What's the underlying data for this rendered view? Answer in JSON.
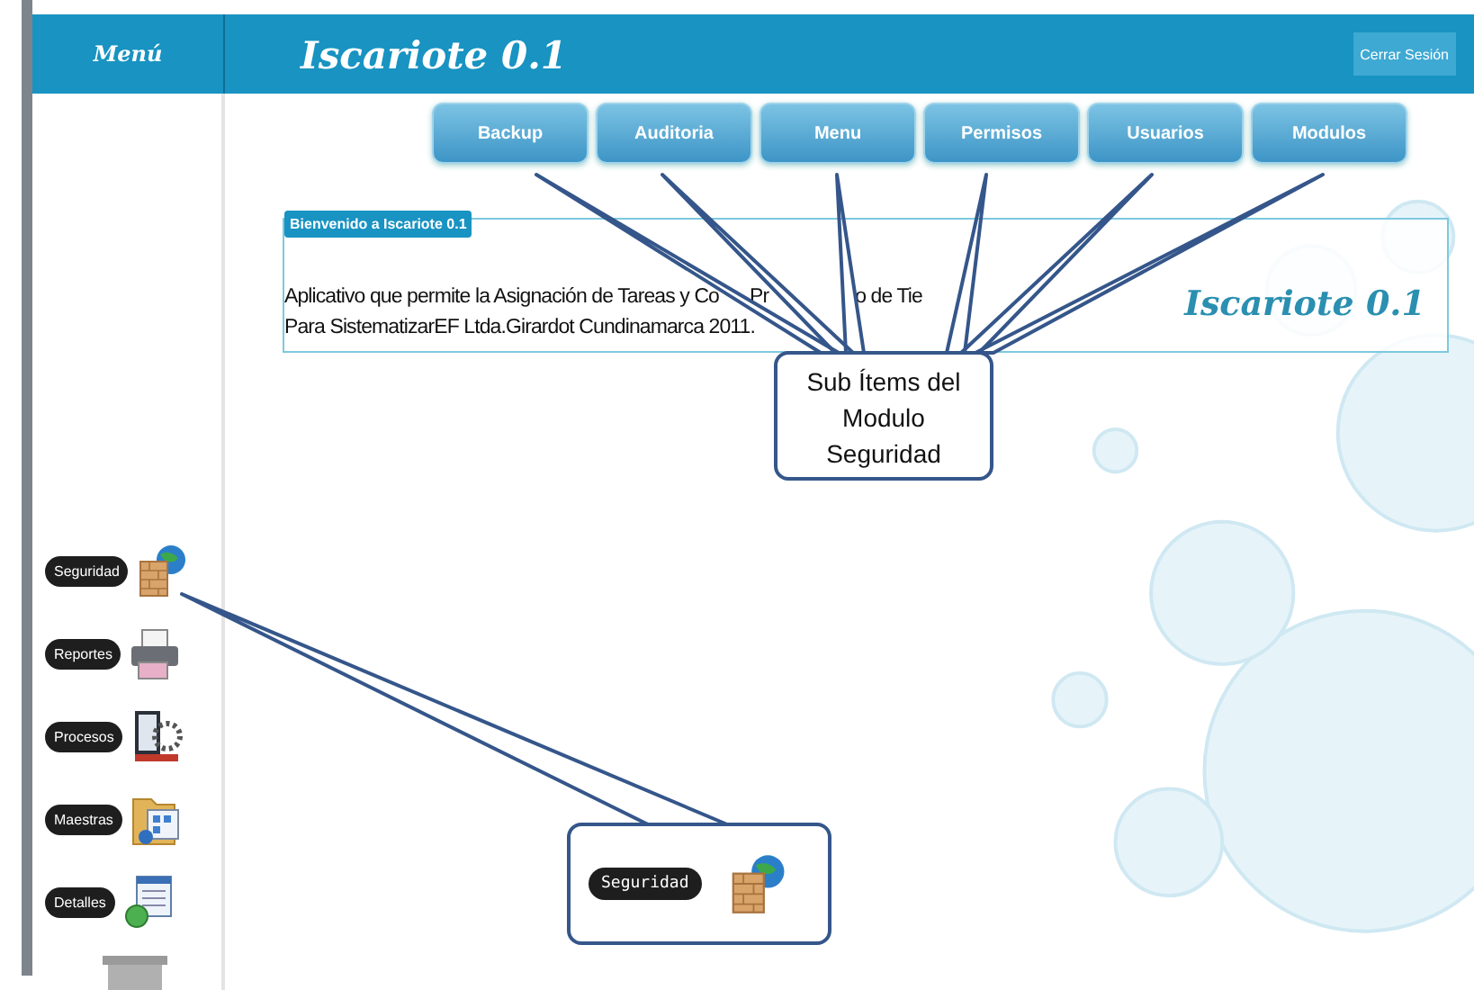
{
  "header": {
    "menu_label": "Menú",
    "logo": "Iscariote 0.1",
    "logout_button": "Cerrar Sesión"
  },
  "nav_buttons": [
    "Backup",
    "Auditoria",
    "Menu",
    "Permisos",
    "Usuarios",
    "Modulos"
  ],
  "welcome": {
    "legend": "Bienvenido a Iscariote 0.1",
    "line_1_fragments": [
      "Aplicativo que permite la Asignación de Tareas y Co",
      "Pr",
      "o de Tie"
    ],
    "line_2": "Para SistematizarEF Ltda.Girardot Cundinamarca 2011.",
    "logo": "Iscariote 0.1"
  },
  "sidebar": {
    "items": [
      {
        "label": "Seguridad",
        "kind": "security"
      },
      {
        "label": "Reportes",
        "kind": "reports"
      },
      {
        "label": "Procesos",
        "kind": "processes"
      },
      {
        "label": "Maestras",
        "kind": "masters"
      },
      {
        "label": "Detalles",
        "kind": "details"
      }
    ]
  },
  "callouts": [
    {
      "kind": "text",
      "text": "Sub Ítems del Modulo Seguridad"
    },
    {
      "kind": "item",
      "label": "Seguridad"
    }
  ]
}
